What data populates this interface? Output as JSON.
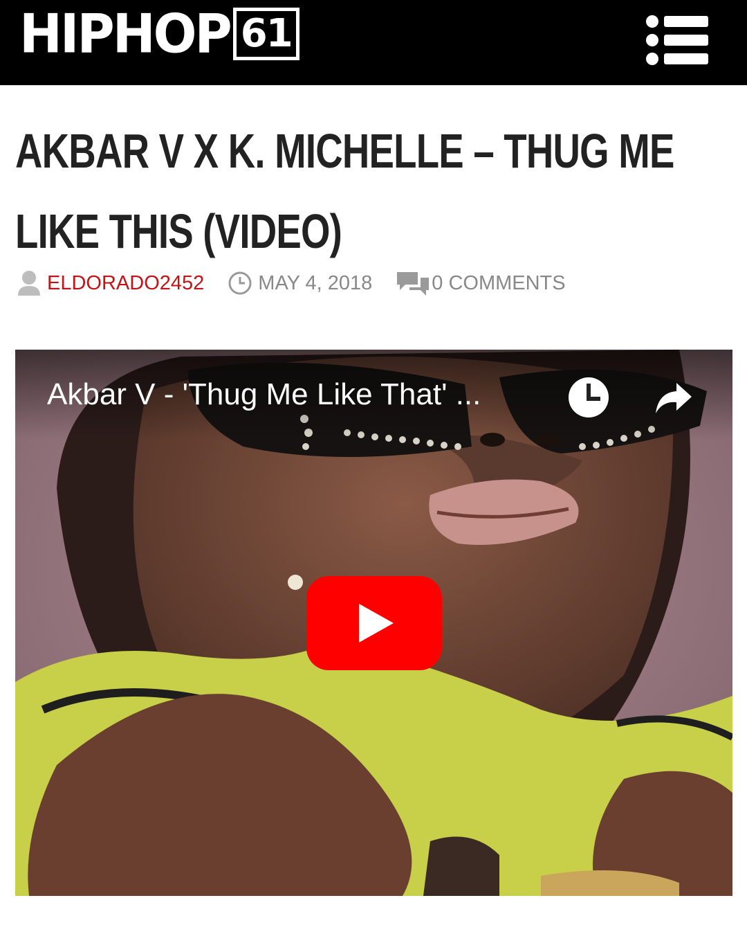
{
  "header": {
    "logo_text": "HIPHOP",
    "logo_badge": "61",
    "menu_icon": "menu-list-icon"
  },
  "article": {
    "title": "Akbar V x K. Michelle – Thug Me Like This (Video)",
    "author": "ELDORADO2452",
    "date": "MAY 4, 2018",
    "comments": "0 COMMENTS",
    "icons": {
      "author": "user-icon",
      "date": "clock-icon",
      "comments": "comments-icon"
    }
  },
  "video": {
    "title": "Akbar V - 'Thug Me Like That' ...",
    "icons": [
      "watch-later-icon",
      "share-icon",
      "play-icon"
    ],
    "play_color": "#ff0000"
  }
}
